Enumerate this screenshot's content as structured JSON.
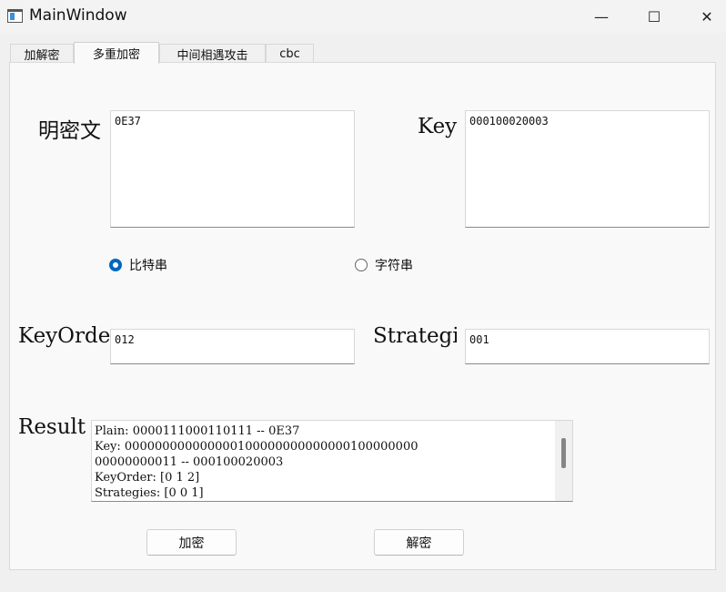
{
  "window": {
    "title": "MainWindow",
    "minimize_glyph": "—",
    "maximize_glyph": "☐",
    "close_glyph": "✕"
  },
  "tabs": [
    {
      "label": "加解密",
      "active": false
    },
    {
      "label": "多重加密",
      "active": true
    },
    {
      "label": "中间相遇攻击",
      "active": false
    },
    {
      "label": "cbc",
      "active": false
    }
  ],
  "form": {
    "plaintext_label": "明密文",
    "plaintext_value": "0E37",
    "key_label": "Key",
    "key_value": "000100020003",
    "mode_options": [
      {
        "label": "比特串",
        "selected": true
      },
      {
        "label": "字符串",
        "selected": false
      }
    ],
    "keyorder_label": "KeyOrder",
    "keyorder_value": "012",
    "strategy_label": "Strategies",
    "strategy_value": "001",
    "result_label": "Result",
    "result_lines": [
      "Plain: 0000111000110111 -- 0E37",
      "Key: 000000000000000100000000000000100000000",
      "00000000011 -- 000100020003",
      "KeyOrder: [0 1 2]",
      "Strategies: [0 0 1]"
    ]
  },
  "buttons": {
    "encrypt": "加密",
    "decrypt": "解密"
  },
  "colors": {
    "accent": "#0067c0",
    "window_bg": "#f0f0f0",
    "panel_bg": "#f9f9f9"
  }
}
